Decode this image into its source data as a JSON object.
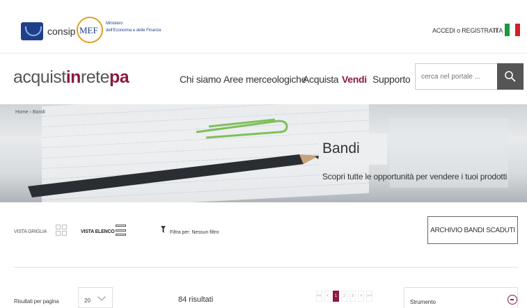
{
  "header": {
    "consip_label": "consip",
    "mef_logo_text": "MEF",
    "mef_line1": "Ministero",
    "mef_line2": "dell'Economia e delle Finanze",
    "login_label": "ACCEDI o REGISTRATI",
    "language": "ITA"
  },
  "brand": {
    "part1": "acquist",
    "part2": "in",
    "part3": "rete",
    "part4": "pa"
  },
  "nav": {
    "items": [
      {
        "label": "Chi siamo"
      },
      {
        "label": "Aree merceologiche"
      },
      {
        "label": "Acquista"
      },
      {
        "label": "Vendi"
      },
      {
        "label": "Supporto"
      }
    ],
    "search_placeholder": "cerca nel portale ..."
  },
  "hero": {
    "breadcrumb": "Home  ›  Bandi",
    "title": "Bandi",
    "subtitle": "Scopri tutte le opportunità per vendere i tuoi prodotti"
  },
  "controls": {
    "grid_view_label": "VISTA GRIGLIA",
    "list_view_label": "VISTA ELENCO",
    "filter_label": "Filtra per: Nessun filtro",
    "archive_button": "ARCHIVIO BANDI SCADUTI"
  },
  "results": {
    "per_page_label": "Risultati per pagina",
    "per_page_value": "20",
    "count_text": "84 risultati",
    "pagination": [
      "<<",
      "<",
      "1",
      "2",
      "3",
      ">",
      ">>"
    ],
    "current_page": "1",
    "filter_panel_label": "Strumento"
  },
  "colors": {
    "accent": "#8b1a3c",
    "flag_green": "#1a9a3a",
    "flag_white": "#ffffff",
    "flag_red": "#d0202a"
  }
}
